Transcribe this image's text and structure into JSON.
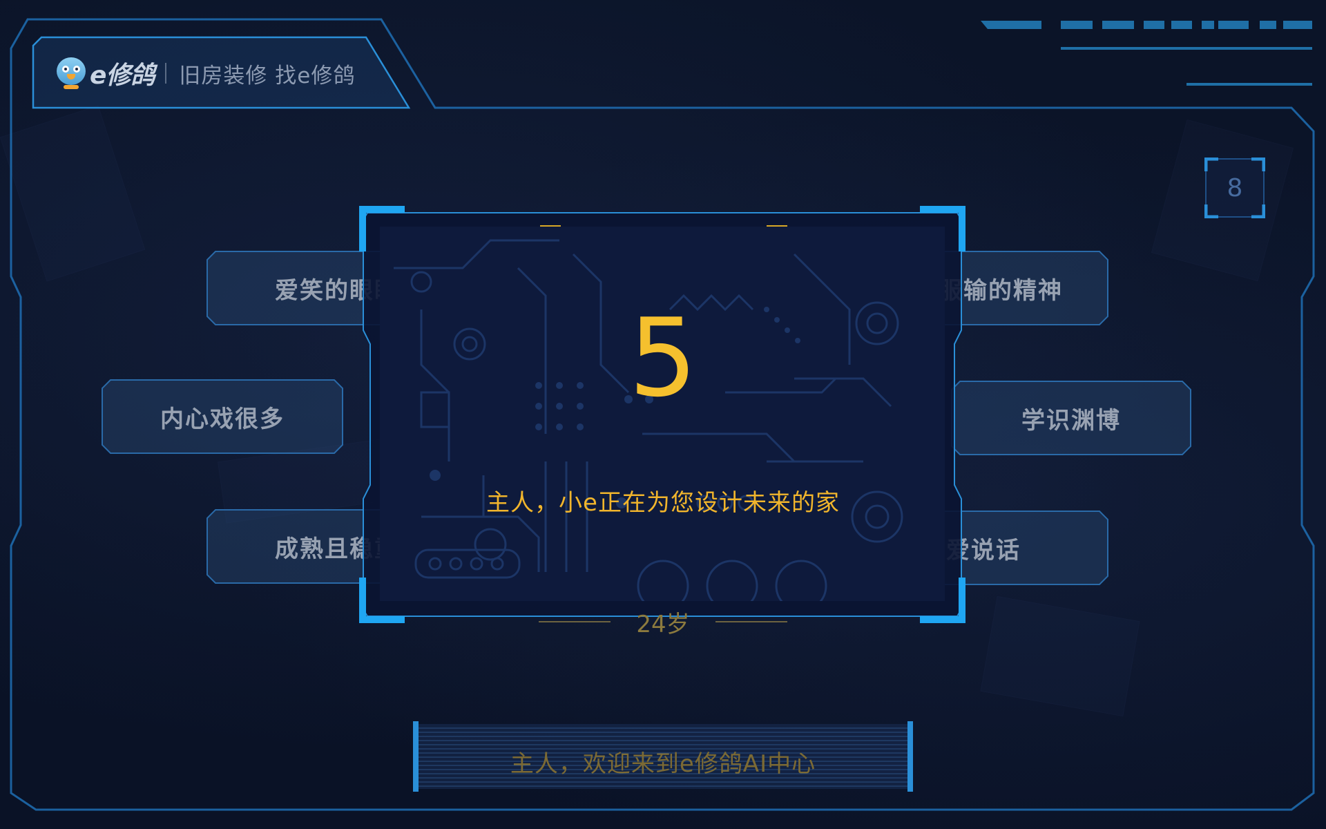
{
  "header": {
    "logo_brand": "e修鸽",
    "slogan": "旧房装修 找e修鸽"
  },
  "timer": {
    "value": "8"
  },
  "traits": {
    "left": [
      "爱笑的眼睛",
      "内心戏很多",
      "成熟且稳重"
    ],
    "right": [
      "不服输的精神",
      "学识渊博",
      "不爱说话"
    ]
  },
  "modal": {
    "countdown": "5",
    "message": "主人，小e正在为您设计未来的家",
    "age": "24岁"
  },
  "footer": {
    "welcome": "主人，欢迎来到e修鸽AI中心"
  },
  "colors": {
    "background": "#0a1226",
    "frame_blue": "#2a8fd8",
    "bracket_blue": "#1fa6f2",
    "countdown_gold": "#f5c02e",
    "trait_text": "#98a2b2"
  },
  "icons": {
    "mascot": "pigeon-mascot-icon"
  }
}
